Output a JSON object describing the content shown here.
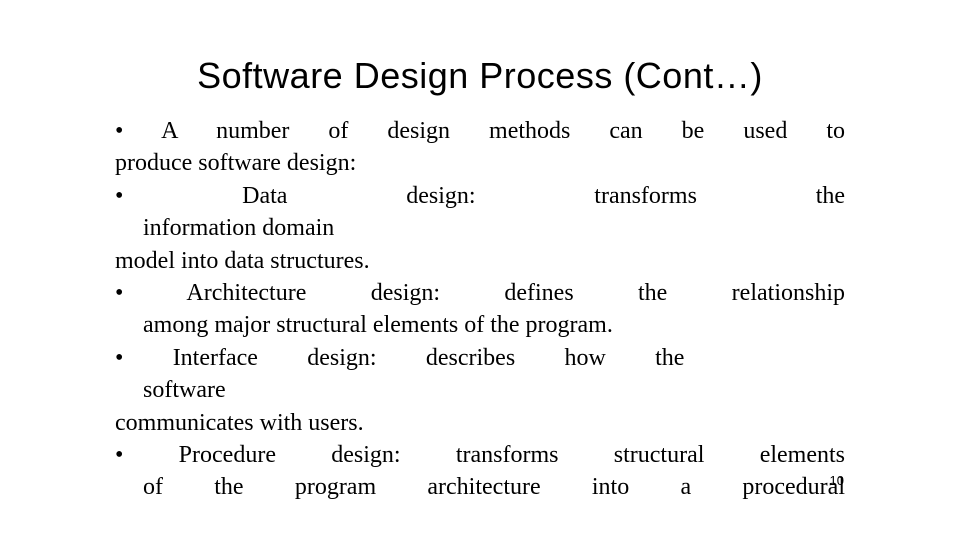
{
  "slide": {
    "title": "Software Design Process (Cont…)",
    "lines": {
      "l1": "• A number of design methods can be used to",
      "l2": "produce software design:",
      "l3a": "• Data",
      "l3b": "design:",
      "l3c": "transforms",
      "l3d": "the",
      "l4": "information domain",
      "l5": "model into data structures.",
      "l6": "• Architecture design: defines the relationship",
      "l7": "among major structural elements of the program.",
      "l8a": "• Interface",
      "l8b": "design:",
      "l8c": "describes how the",
      "l9": "software",
      "l10": "communicates with users.",
      "l11": "• Procedure design: transforms structural elements",
      "l12": "of the program architecture into a procedural"
    },
    "page_number": "10"
  }
}
